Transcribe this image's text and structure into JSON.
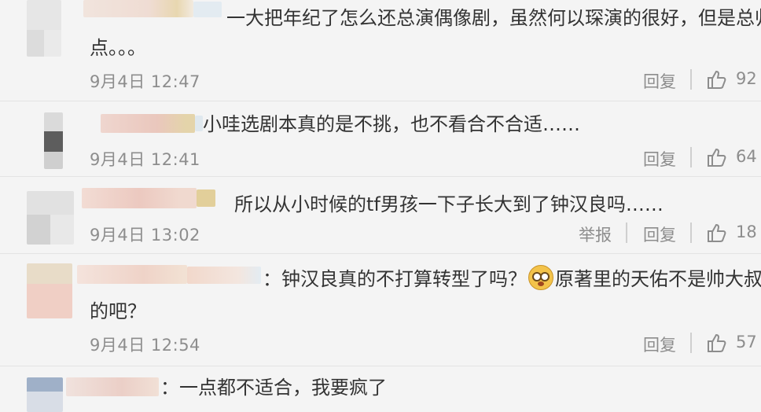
{
  "comments": [
    {
      "text_line1": "一大把年纪了怎么还总演偶像剧，虽然何以琛演的很好，但是总归有",
      "text_line2": "点。。。",
      "time": "9月4日 12:47",
      "reply_label": "回复",
      "likes": "92"
    },
    {
      "text_line1": "小哇选剧本真的是不挑，也不看合不合适……",
      "time": "9月4日 12:41",
      "reply_label": "回复",
      "likes": "64"
    },
    {
      "text_line1": "所以从小时候的tf男孩一下子长大到了钟汉良吗……",
      "time": "9月4日 13:02",
      "report_label": "举报",
      "reply_label": "回复",
      "likes": "18"
    },
    {
      "text_line1_a": "：钟汉良真的不打算转型了吗？",
      "text_line1_b": "原著里的天佑不是帅大叔型",
      "text_line2": "的吧？",
      "time": "9月4日 12:54",
      "reply_label": "回复",
      "likes": "57"
    },
    {
      "text_line1": "：一点都不适合，我要疯了"
    }
  ],
  "icons": {
    "like": "thumbs-up-icon",
    "emoji": "flushed-face-icon"
  },
  "colors": {
    "text": "#333333",
    "meta": "#8d8d8d",
    "background": "#f4f4f4"
  }
}
